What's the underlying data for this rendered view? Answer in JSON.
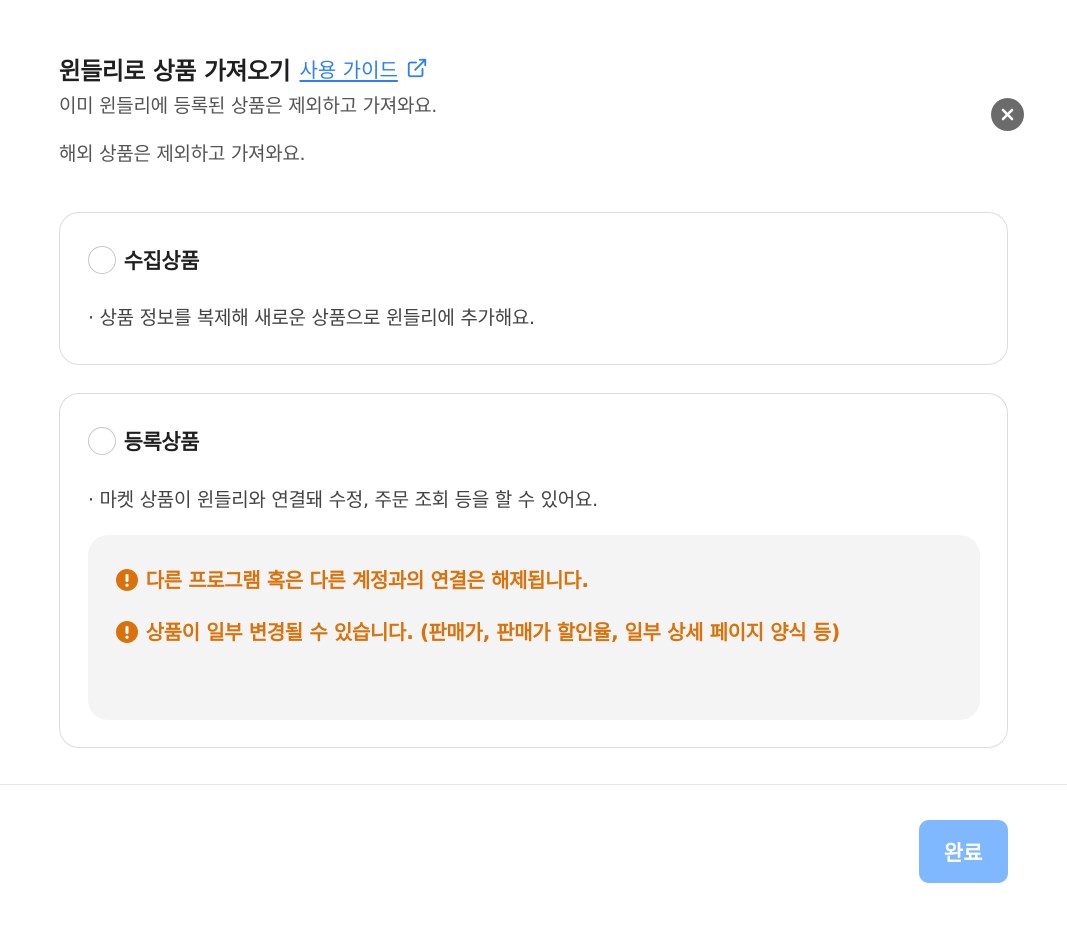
{
  "header": {
    "title": "윈들리로 상품 가져오기",
    "guide_link": "사용 가이드",
    "desc_lines": [
      "이미 윈들리에 등록된 상품은 제외하고 가져와요.",
      "해외 상품은 제외하고 가져와요."
    ]
  },
  "options": [
    {
      "label": "수집상품",
      "description": "· 상품 정보를 복제해 새로운 상품으로 윈들리에 추가해요.",
      "selected": false
    },
    {
      "label": "등록상품",
      "description": "· 마켓 상품이 윈들리와 연결돼 수정, 주문 조회 등을 할 수 있어요.",
      "selected": false,
      "warnings": [
        "다른 프로그램 혹은 다른 계정과의 연결은 해제됩니다.",
        "상품이 일부 변경될 수 있습니다. (판매가, 판매가 할인율, 일부 상세 페이지 양식 등)"
      ]
    }
  ],
  "footer": {
    "done_label": "완료"
  },
  "icons": {
    "external_link": "external-link-icon",
    "close": "close-icon",
    "warning": "exclamation-circle-icon"
  },
  "colors": {
    "link": "#2d7ff9",
    "warning": "#d9720a",
    "done_button": "#7fb8ff",
    "close_button": "#6b6b6b"
  }
}
